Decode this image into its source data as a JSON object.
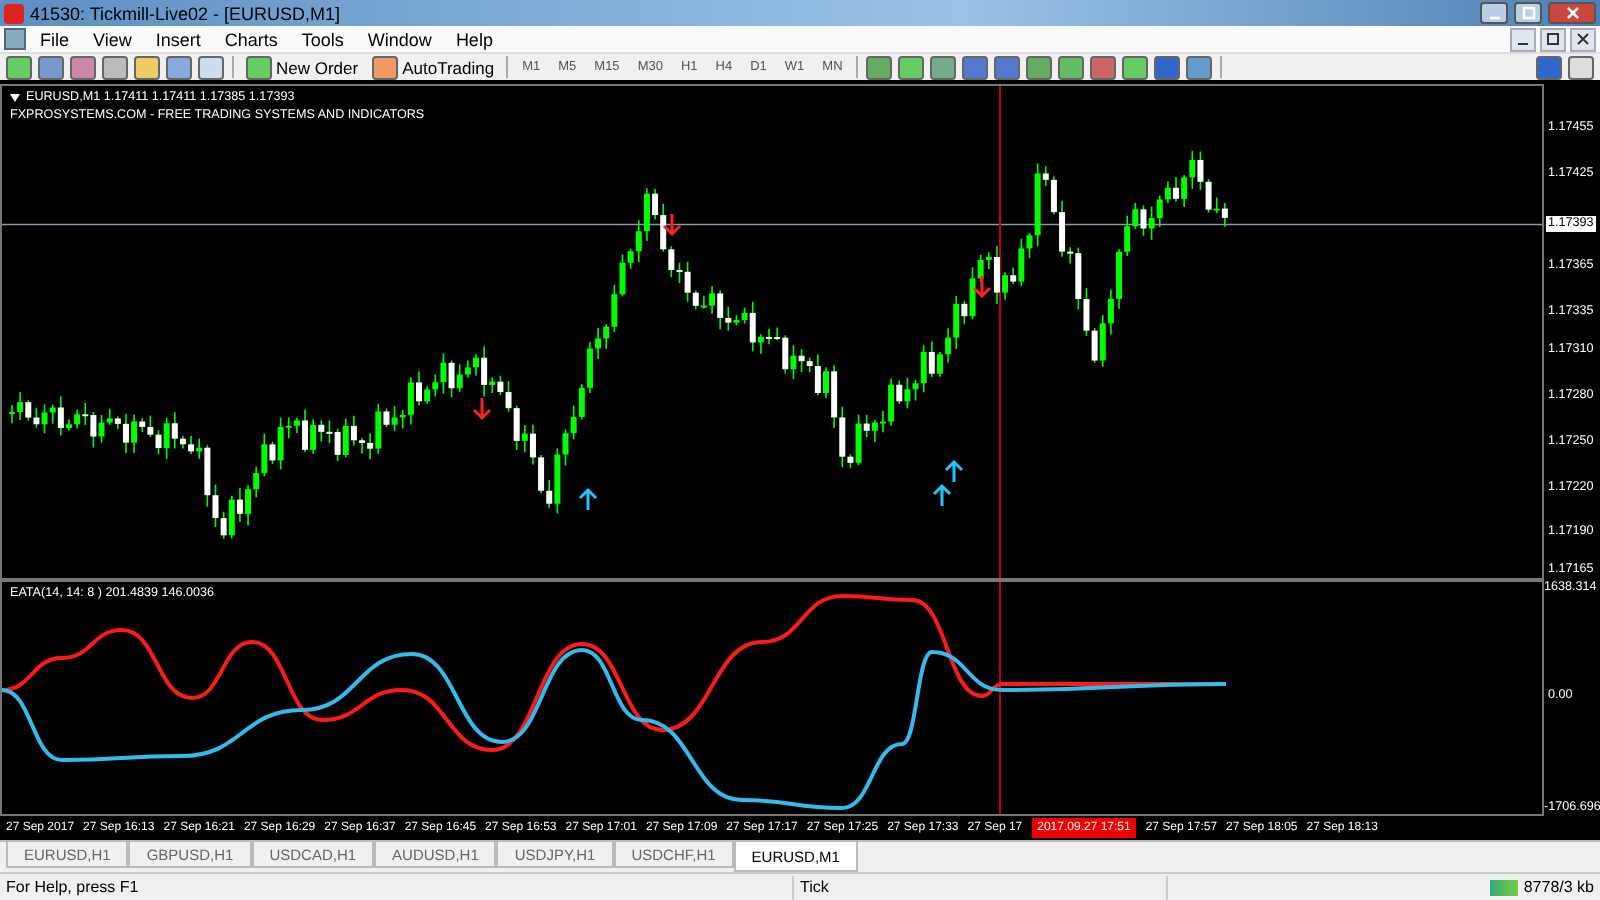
{
  "window": {
    "title": "41530: Tickmill-Live02 - [EURUSD,M1]"
  },
  "menu": [
    "File",
    "View",
    "Insert",
    "Charts",
    "Tools",
    "Window",
    "Help"
  ],
  "toolbar": {
    "text_buttons": [
      "New Order",
      "AutoTrading"
    ],
    "timeframes": [
      "M1",
      "M5",
      "M15",
      "M30",
      "H1",
      "H4",
      "D1",
      "W1",
      "MN"
    ]
  },
  "chart": {
    "symbol_line": "EURUSD,M1  1.17411 1.17411 1.17385 1.17393",
    "subtitle": "FXPROSYSTEMS.COM - FREE TRADING SYSTEMS AND INDICATORS",
    "price_ticks": [
      "1.17455",
      "1.17425",
      "1.17365",
      "1.17335",
      "1.17310",
      "1.17280",
      "1.17250",
      "1.17220",
      "1.17190",
      "1.17165"
    ],
    "current_price": "1.17393",
    "indicator": {
      "label": "EATA(14, 14: 8 ) 201.4839 146.0036",
      "ticks": [
        "1638.314",
        "0.00",
        "-1706.696"
      ]
    },
    "time_ticks": [
      "27 Sep 2017",
      "27 Sep 16:13",
      "27 Sep 16:21",
      "27 Sep 16:29",
      "27 Sep 16:37",
      "27 Sep 16:45",
      "27 Sep 16:53",
      "27 Sep 17:01",
      "27 Sep 17:09",
      "27 Sep 17:17",
      "27 Sep 17:25",
      "27 Sep 17:33",
      "27 Sep 17"
    ],
    "time_cursor": "2017.09.27 17:51",
    "time_ticks_after": [
      "27 Sep 17:57",
      "27 Sep 18:05",
      "27 Sep 18:13"
    ]
  },
  "tabs": [
    {
      "label": "EURUSD,H1",
      "selected": false
    },
    {
      "label": "GBPUSD,H1",
      "selected": false
    },
    {
      "label": "USDCAD,H1",
      "selected": false
    },
    {
      "label": "AUDUSD,H1",
      "selected": false
    },
    {
      "label": "USDJPY,H1",
      "selected": false
    },
    {
      "label": "USDCHF,H1",
      "selected": false
    },
    {
      "label": "EURUSD,M1",
      "selected": true
    }
  ],
  "status_bar": {
    "help": "For Help, press F1",
    "mode": "Tick",
    "traffic": "8778/3 kb"
  }
}
